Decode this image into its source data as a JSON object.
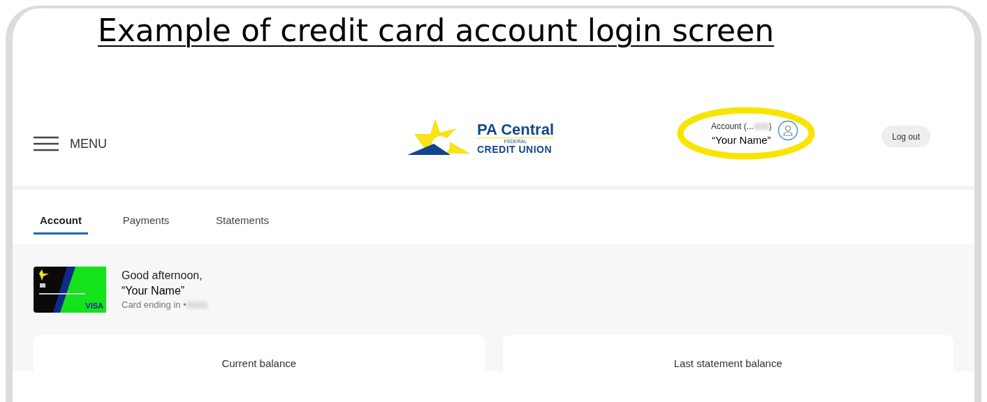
{
  "title": "Example of credit card account login screen",
  "header": {
    "menu_label": "MENU",
    "logo": {
      "line1": "PA Central",
      "small": "FEDERAL",
      "line2": "CREDIT UNION"
    },
    "account": {
      "label": "Account (...",
      "label_end": ")",
      "name": "“Your Name”",
      "highlighted": true
    },
    "logout": "Log out"
  },
  "tabs": [
    {
      "label": "Account",
      "selected": true
    },
    {
      "label": "Payments",
      "selected": false
    },
    {
      "label": "Statements",
      "selected": false
    }
  ],
  "greeting": {
    "card_brand": "VISA",
    "line1": "Good afternoon,",
    "name": "“Your Name”",
    "card_ending": "Card ending in •"
  },
  "balances": [
    {
      "label": "Current balance"
    },
    {
      "label": "Last statement balance"
    }
  ]
}
